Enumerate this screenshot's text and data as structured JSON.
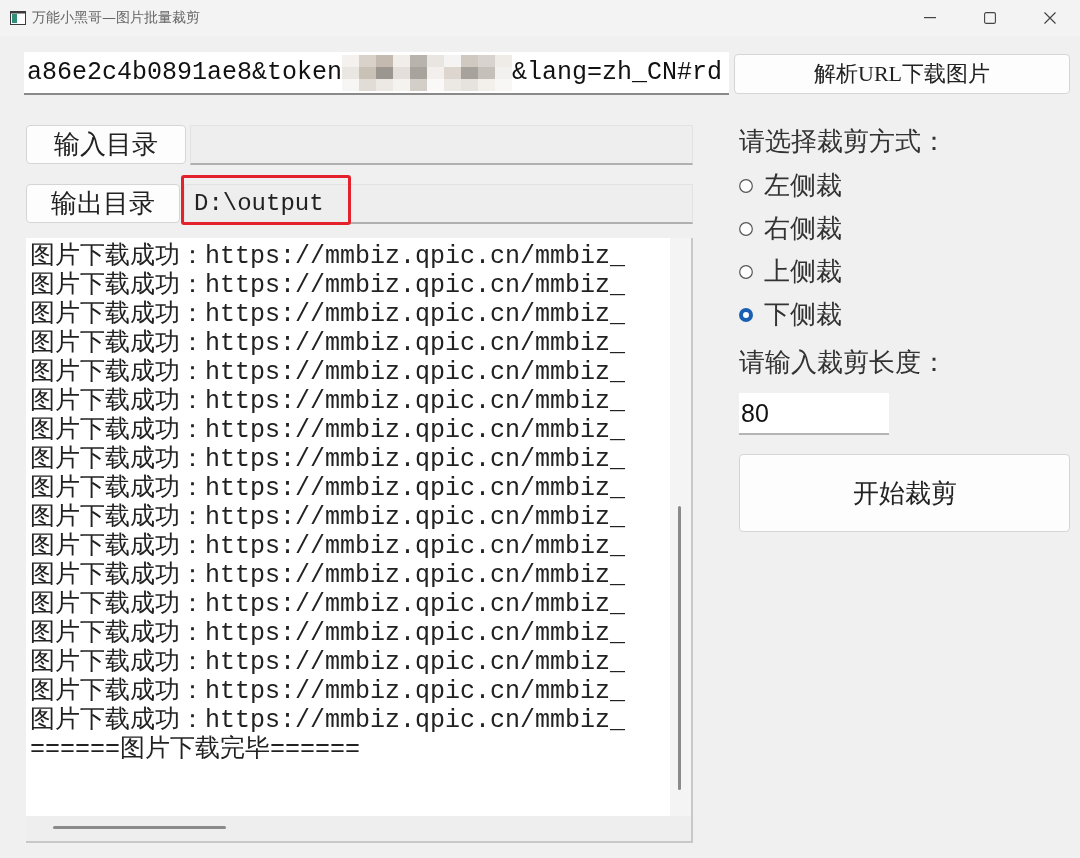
{
  "window": {
    "title": "万能小黑哥—图片批量裁剪"
  },
  "url_bar": {
    "value_start": "a86e2c4b0891ae8&token",
    "redacted": true,
    "value_end": "&lang=zh_CN#rd",
    "button": "解析URL下载图片"
  },
  "input_dir": {
    "button": "输入目录"
  },
  "output_dir": {
    "button": "输出目录",
    "value": "D:\\output",
    "highlighted": true
  },
  "log": {
    "lines": [
      "图片下载成功：https://mmbiz.qpic.cn/mmbiz_",
      "图片下载成功：https://mmbiz.qpic.cn/mmbiz_",
      "图片下载成功：https://mmbiz.qpic.cn/mmbiz_",
      "图片下载成功：https://mmbiz.qpic.cn/mmbiz_",
      "图片下载成功：https://mmbiz.qpic.cn/mmbiz_",
      "图片下载成功：https://mmbiz.qpic.cn/mmbiz_",
      "图片下载成功：https://mmbiz.qpic.cn/mmbiz_",
      "图片下载成功：https://mmbiz.qpic.cn/mmbiz_",
      "图片下载成功：https://mmbiz.qpic.cn/mmbiz_",
      "图片下载成功：https://mmbiz.qpic.cn/mmbiz_",
      "图片下载成功：https://mmbiz.qpic.cn/mmbiz_",
      "图片下载成功：https://mmbiz.qpic.cn/mmbiz_",
      "图片下载成功：https://mmbiz.qpic.cn/mmbiz_",
      "图片下载成功：https://mmbiz.qpic.cn/mmbiz_",
      "图片下载成功：https://mmbiz.qpic.cn/mmbiz_",
      "图片下载成功：https://mmbiz.qpic.cn/mmbiz_",
      "图片下载成功：https://mmbiz.qpic.cn/mmbiz_",
      "======图片下载完毕======"
    ]
  },
  "crop_mode": {
    "label": "请选择裁剪方式：",
    "options": [
      {
        "label": "左侧裁",
        "selected": false
      },
      {
        "label": "右侧裁",
        "selected": false
      },
      {
        "label": "上侧裁",
        "selected": false
      },
      {
        "label": "下侧裁",
        "selected": true
      }
    ]
  },
  "crop_length": {
    "label": "请输入裁剪长度：",
    "value": "80"
  },
  "start_button": "开始裁剪"
}
